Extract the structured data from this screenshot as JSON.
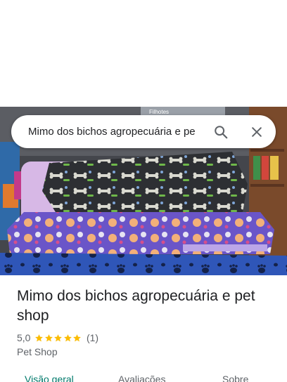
{
  "search": {
    "query": "Mimo dos bichos agropecuária e pe",
    "search_icon": "search-icon",
    "close_icon": "close-icon"
  },
  "hero_image": {
    "description_icon": "place-photo",
    "sign_text": "Filhotes"
  },
  "place": {
    "title": "Mimo dos bichos agropecuária e pet shop",
    "rating": "5,0",
    "stars": 5,
    "review_count": "(1)",
    "category": "Pet Shop"
  },
  "tabs": [
    {
      "label": "Visão geral",
      "active": true
    },
    {
      "label": "Avaliações",
      "active": false
    },
    {
      "label": "Sobre",
      "active": false
    }
  ],
  "colors": {
    "accent": "#00796b",
    "star": "#fbbc04",
    "text": "#202124",
    "secondary_text": "#5f6368"
  }
}
